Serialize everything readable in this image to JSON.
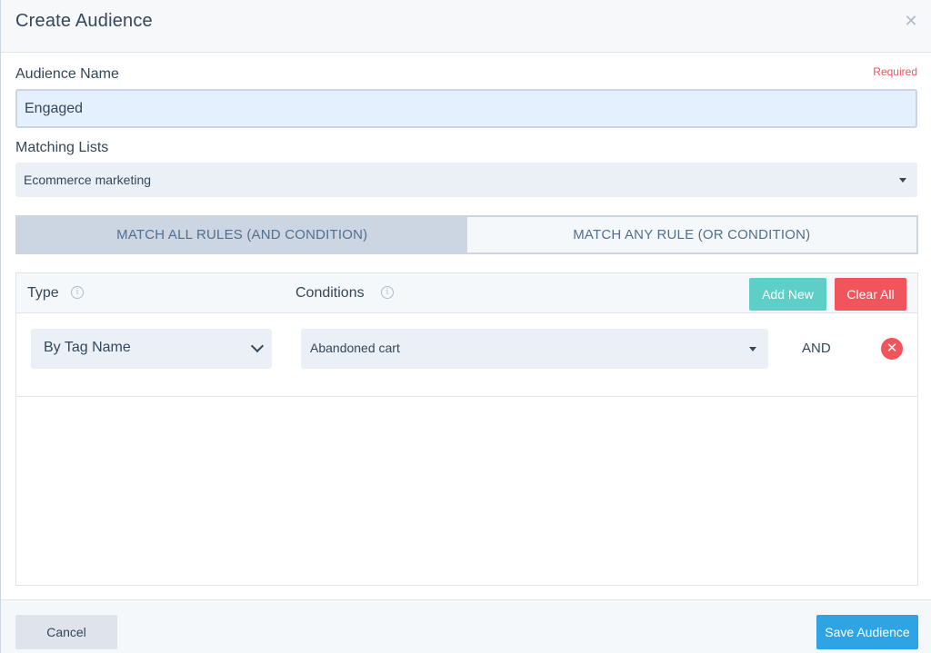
{
  "modal": {
    "title": "Create Audience",
    "close_icon": "close-icon"
  },
  "audience_name": {
    "label": "Audience Name",
    "required": "Required",
    "value": "Engaged"
  },
  "matching_lists": {
    "label": "Matching Lists",
    "selected": "Ecommerce marketing"
  },
  "match_mode": {
    "options": [
      {
        "label": "MATCH ALL RULES (AND CONDITION)",
        "active": true
      },
      {
        "label": "MATCH ANY RULE (OR CONDITION)",
        "active": false
      }
    ]
  },
  "rules": {
    "type_label": "Type",
    "conditions_label": "Conditions",
    "add_new_label": "Add New",
    "clear_all_label": "Clear All",
    "rows": [
      {
        "type": "By Tag Name",
        "condition": "Abandoned cart",
        "operator": "AND"
      }
    ]
  },
  "footer": {
    "cancel_label": "Cancel",
    "save_label": "Save Audience"
  },
  "colors": {
    "add_new": "#5ecfc6",
    "clear_all": "#f2545b",
    "save": "#2ea4e5",
    "required": "#f2545b"
  }
}
